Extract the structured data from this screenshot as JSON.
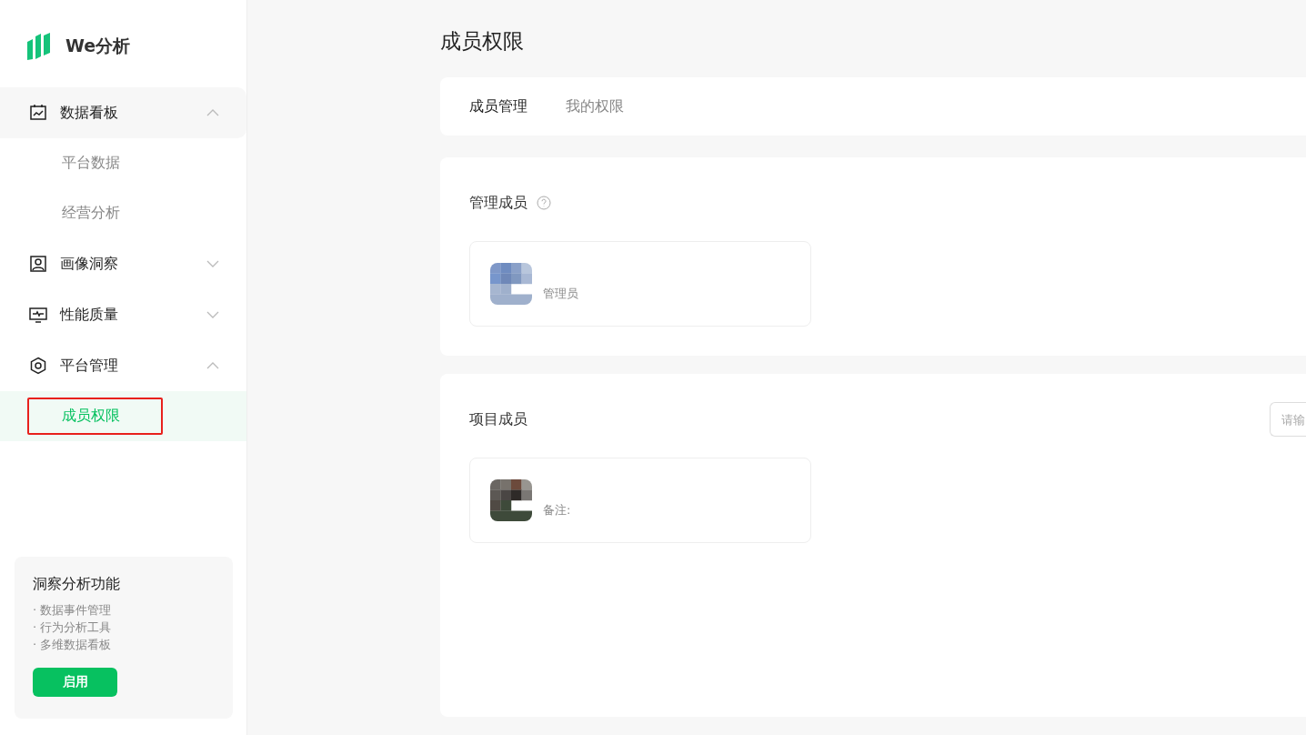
{
  "brand": {
    "name": "We分析"
  },
  "menu": [
    {
      "label": "数据看板",
      "expanded": true,
      "children": [
        {
          "label": "平台数据",
          "selected": false,
          "outlined": false
        },
        {
          "label": "经营分析",
          "selected": false,
          "outlined": false
        }
      ]
    },
    {
      "label": "画像洞察",
      "expanded": false
    },
    {
      "label": "性能质量",
      "expanded": false
    },
    {
      "label": "平台管理",
      "expanded": true,
      "children": [
        {
          "label": "成员权限",
          "selected": true,
          "outlined": true
        }
      ]
    }
  ],
  "promo": {
    "title": "洞察分析功能",
    "features": [
      "· 数据事件管理",
      "· 行为分析工具",
      "· 多维数据看板"
    ],
    "button": "启用"
  },
  "page_title": "成员权限",
  "tabs": [
    {
      "label": "成员管理",
      "selected": true
    },
    {
      "label": "我的权限",
      "selected": false
    }
  ],
  "admins": {
    "title": "管理成员",
    "members": [
      {
        "note": "管理员"
      }
    ]
  },
  "project": {
    "title": "项目成员",
    "search": {
      "placeholder": "请输"
    },
    "members": [
      {
        "note": "备注:"
      }
    ]
  }
}
